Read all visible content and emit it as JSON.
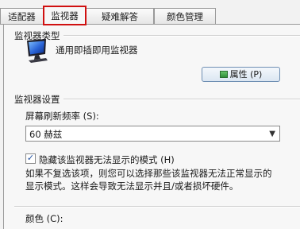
{
  "tabs": [
    {
      "label": "适配器"
    },
    {
      "label": "监视器"
    },
    {
      "label": "疑难解答"
    },
    {
      "label": "颜色管理"
    }
  ],
  "monitor_type": {
    "title": "监视器类型",
    "name": "通用即插即用监视器",
    "properties_button": "属性 (P)"
  },
  "monitor_settings": {
    "title": "监视器设置",
    "refresh_label": "屏幕刷新频率 (S):",
    "refresh_value": "60 赫兹",
    "hide_modes_label": "隐藏该监视器无法显示的模式 (H)",
    "hide_modes_checked": true,
    "description_line1": "如果不复选该项，则您可以选择那些该监视器无法正常显示的",
    "description_line2": "显示模式。这样会导致无法显示并且/或者损坏硬件。"
  },
  "colors": {
    "title": "颜色 (C):"
  }
}
